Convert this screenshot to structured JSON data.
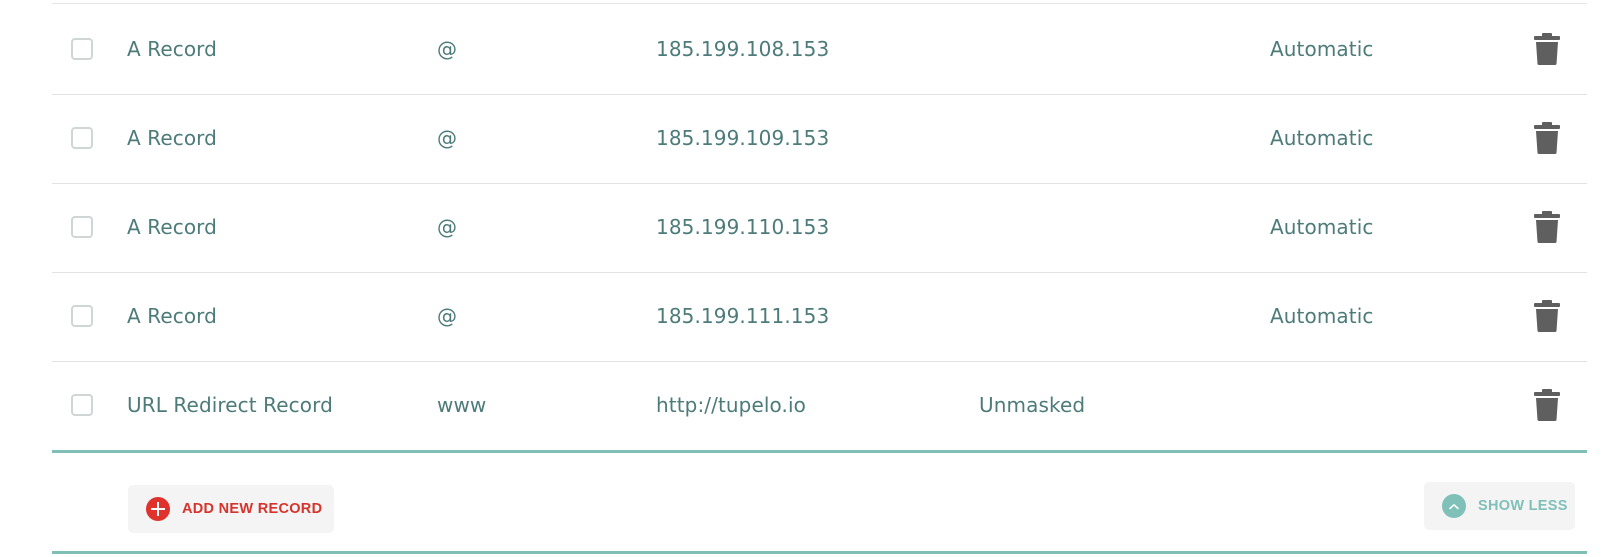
{
  "records": [
    {
      "type": "A Record",
      "host": "@",
      "value": "185.199.108.153",
      "extra": "",
      "ttl": "Automatic"
    },
    {
      "type": "A Record",
      "host": "@",
      "value": "185.199.109.153",
      "extra": "",
      "ttl": "Automatic"
    },
    {
      "type": "A Record",
      "host": "@",
      "value": "185.199.110.153",
      "extra": "",
      "ttl": "Automatic"
    },
    {
      "type": "A Record",
      "host": "@",
      "value": "185.199.111.153",
      "extra": "",
      "ttl": "Automatic"
    },
    {
      "type": "URL Redirect Record",
      "host": "www",
      "value": "http://tupelo.io",
      "extra": "Unmasked",
      "ttl": ""
    }
  ],
  "footer": {
    "add_label": "ADD NEW RECORD",
    "show_less_label": "SHOW LESS"
  },
  "icons": {
    "delete": "trash-icon",
    "add": "plus-circle-icon",
    "collapse": "chevron-up-icon"
  },
  "colors": {
    "text": "#4d7b7a",
    "accent_teal": "#7fbfb6",
    "add_red": "#e0322c",
    "trash": "#5f5f5f"
  }
}
